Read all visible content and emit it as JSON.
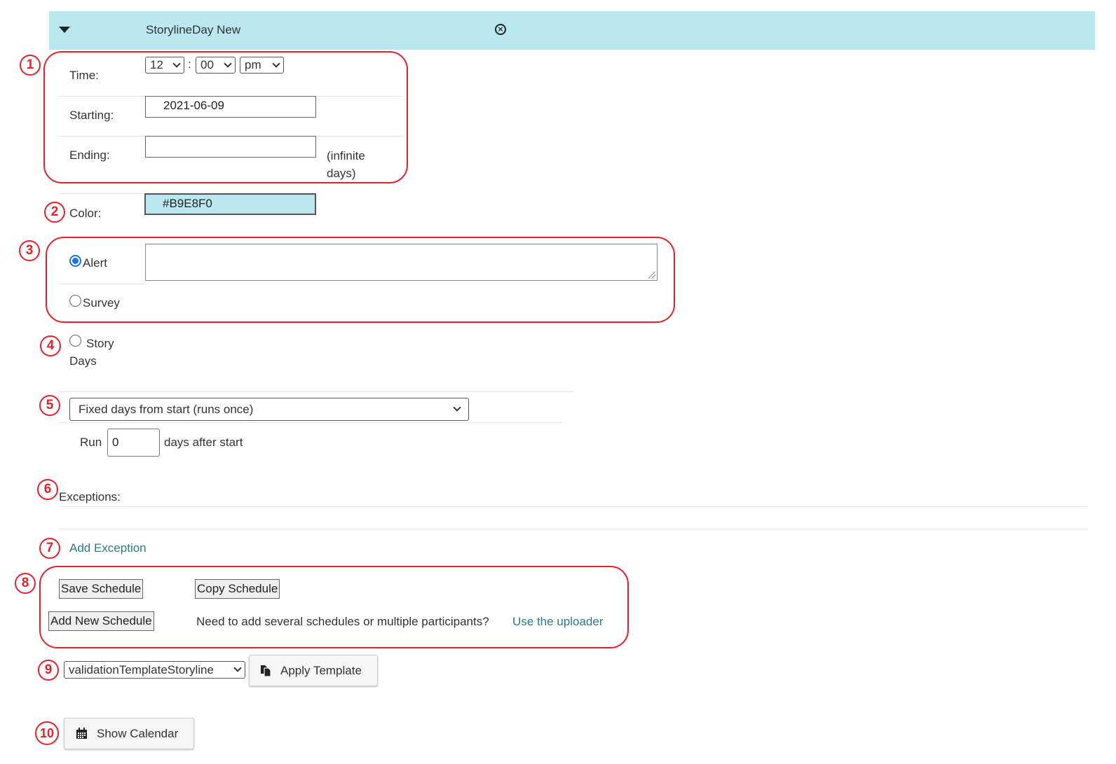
{
  "header": {
    "title": "StorylineDay New",
    "toggle_icon": "caret-down-icon",
    "close_icon": "close-circle-icon",
    "background": "#b9e8f0"
  },
  "time": {
    "label": "Time:",
    "hour": "12",
    "separator": ":",
    "minute": "00",
    "ampm": "pm"
  },
  "starting": {
    "label": "Starting:",
    "value": "2021-06-09"
  },
  "ending": {
    "label": "Ending:",
    "value": "",
    "note_line1": "(infinite",
    "note_line2": "days)"
  },
  "color": {
    "label": "Color:",
    "value": "#B9E8F0"
  },
  "mode": {
    "alert_label": "Alert",
    "survey_label": "Survey",
    "alert_text": "",
    "selected": "Alert"
  },
  "storydays": {
    "label_line1": "Story",
    "label_line2": "Days"
  },
  "schedule_type": {
    "selected": "Fixed days from start (runs once)",
    "run_label": "Run",
    "run_value": "0",
    "run_suffix": "days after start"
  },
  "exceptions": {
    "label": "Exceptions:",
    "add_link": "Add Exception"
  },
  "actions": {
    "save": "Save Schedule",
    "copy": "Copy Schedule",
    "add_new": "Add New Schedule",
    "uploader_text": "Need to add several schedules or multiple participants?",
    "uploader_link": "Use the uploader"
  },
  "template": {
    "selected": "validationTemplateStoryline",
    "apply_label": "Apply Template",
    "apply_icon": "copy-icon"
  },
  "calendar": {
    "label": "Show Calendar",
    "icon": "calendar-icon"
  },
  "markers": [
    "1",
    "2",
    "3",
    "4",
    "5",
    "6",
    "7",
    "8",
    "9",
    "10"
  ],
  "colors": {
    "annotation_red": "#e5202a",
    "link": "#2a7a86",
    "radio_blue": "#1a73e8"
  }
}
